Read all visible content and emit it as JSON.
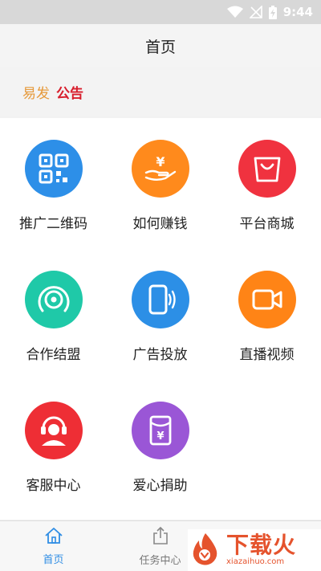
{
  "status_bar": {
    "time": "9:44"
  },
  "header": {
    "title": "首页"
  },
  "notice": {
    "brand": "易发",
    "label": "公告"
  },
  "grid": {
    "items": [
      {
        "label": "推广二维码",
        "icon": "qr-code-icon",
        "color": "#2d8fe8"
      },
      {
        "label": "如何赚钱",
        "icon": "earn-money-icon",
        "color": "#ff8a1c"
      },
      {
        "label": "平台商城",
        "icon": "shopping-bag-icon",
        "color": "#f0323f"
      },
      {
        "label": "合作结盟",
        "icon": "target-icon",
        "color": "#1fc9a8"
      },
      {
        "label": "广告投放",
        "icon": "phone-broadcast-icon",
        "color": "#2c8fe6"
      },
      {
        "label": "直播视频",
        "icon": "video-camera-icon",
        "color": "#ff8416"
      },
      {
        "label": "客服中心",
        "icon": "headset-user-icon",
        "color": "#ee2e35"
      },
      {
        "label": "爱心捐助",
        "icon": "red-envelope-icon",
        "color": "#9a56d6"
      }
    ]
  },
  "tabbar": {
    "tabs": [
      {
        "label": "首页",
        "icon": "home-icon",
        "active": true
      },
      {
        "label": "任务中心",
        "icon": "share-upload-icon",
        "active": false
      }
    ]
  },
  "watermark": {
    "main": "下载火",
    "sub": "xiazaihuo.com"
  },
  "colors": {
    "accent": "#2f8de4",
    "notice_red": "#d81e2c",
    "brand_orange": "#e6993a"
  }
}
